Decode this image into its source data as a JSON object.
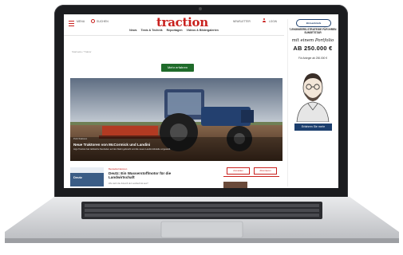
{
  "site": {
    "logo": "traction",
    "menu_label": "MENU",
    "search_label": "SUCHEN",
    "mail_label": "NEWSLETTER",
    "login_label": "LOGIN",
    "nav_items": [
      "News",
      "Tests & Technik",
      "Reportagen",
      "Videos & Bildergalerien"
    ],
    "breadcrumb": "Startseite / Traktor",
    "cta_label": "Mehr erfahren"
  },
  "hero": {
    "tag": "Profi-Traktoren",
    "title": "Neue Traktoren von McCormick und Landini",
    "subtitle": "Argo Tractors hat zahlreiche Neuheiten auf den Markt gebracht und die neuen Landini-Modelle vorgestellt."
  },
  "article": {
    "thumb_text": "Deutz",
    "kicker": "Bestsellertraktoren",
    "title": "Deutz: Ein Wasserstoffmotor für die Landwirtschaft",
    "subtitle": "Wie sieht die Zukunft der Landtechnik aus?"
  },
  "side_buttons": [
    "Anmelden",
    "Abonnieren"
  ],
  "ad": {
    "logo": "Börsenbriefe",
    "strategy": "7-ENGINEERS-STRATEGIE FÜR IHREN SUNSETSTAR",
    "script": "mit einem Portfolio",
    "amount": "AB 250.000 €",
    "small": "Für Anleger ab 250.000 €",
    "button": "Erfahren Sie mehr"
  },
  "colors": {
    "brand_red": "#c9211e",
    "cta_green": "#1f6b2a",
    "ad_navy": "#1c3f6e"
  }
}
